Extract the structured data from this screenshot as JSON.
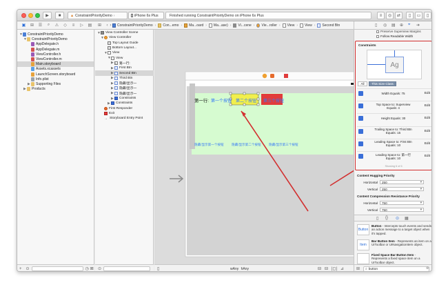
{
  "window": {
    "scheme_target": "ConstraintPriorityDemo",
    "scheme_device": "iPhone 6s Plus",
    "status_text": "Finished running ConstraintPriorityDemo on iPhone 6s Plus"
  },
  "jumpbar": [
    "ConstraintPriorityDemo",
    "Con...emo",
    "Ma...oard",
    "Ma...ase)",
    "Vi...cene",
    "Vie...roller",
    "View",
    "View",
    "Second Btn"
  ],
  "navigator": {
    "items": [
      {
        "label": "ConstraintPriorityDemo",
        "icon": "project",
        "level": 0,
        "disclosure": "▼",
        "selected": false
      },
      {
        "label": "ConstraintPriorityDemo",
        "icon": "folder",
        "level": 1,
        "disclosure": "▼",
        "selected": false
      },
      {
        "label": "AppDelegate.h",
        "icon": "h",
        "level": 2,
        "disclosure": "",
        "selected": false
      },
      {
        "label": "AppDelegate.m",
        "icon": "m",
        "level": 2,
        "disclosure": "",
        "selected": false
      },
      {
        "label": "ViewController.h",
        "icon": "h",
        "level": 2,
        "disclosure": "",
        "selected": false
      },
      {
        "label": "ViewController.m",
        "icon": "m",
        "level": 2,
        "disclosure": "",
        "selected": false
      },
      {
        "label": "Main.storyboard",
        "icon": "sb",
        "level": 2,
        "disclosure": "",
        "selected": true
      },
      {
        "label": "Assets.xcassets",
        "icon": "assets",
        "level": 2,
        "disclosure": "",
        "selected": false
      },
      {
        "label": "LaunchScreen.storyboard",
        "icon": "sb",
        "level": 2,
        "disclosure": "",
        "selected": false
      },
      {
        "label": "Info.plist",
        "icon": "plist",
        "level": 2,
        "disclosure": "",
        "selected": false
      },
      {
        "label": "Supporting Files",
        "icon": "folder",
        "level": 2,
        "disclosure": "▶",
        "selected": false
      },
      {
        "label": "Products",
        "icon": "folder",
        "level": 1,
        "disclosure": "▶",
        "selected": false
      }
    ]
  },
  "outline": {
    "items": [
      {
        "label": "View Controller Scene",
        "icon": "scene",
        "level": 0,
        "disclosure": "▼",
        "selected": false
      },
      {
        "label": "View Controller",
        "icon": "vc",
        "level": 1,
        "disclosure": "▼",
        "selected": false
      },
      {
        "label": "Top Layout Guide",
        "icon": "guide",
        "level": 2,
        "disclosure": "",
        "selected": false
      },
      {
        "label": "Bottom Layout...",
        "icon": "guide",
        "level": 2,
        "disclosure": "",
        "selected": false
      },
      {
        "label": "View",
        "icon": "view",
        "level": 2,
        "disclosure": "▼",
        "selected": false
      },
      {
        "label": "View",
        "icon": "view",
        "level": 3,
        "disclosure": "▼",
        "selected": false
      },
      {
        "label": "第一行:",
        "icon": "label",
        "level": 4,
        "disclosure": "▶",
        "selected": false
      },
      {
        "label": "First Btn",
        "icon": "button",
        "level": 4,
        "disclosure": "▶",
        "selected": false
      },
      {
        "label": "Second Btn",
        "icon": "button",
        "level": 4,
        "disclosure": "▶",
        "selected": true
      },
      {
        "label": "Third Btn",
        "icon": "button",
        "level": 4,
        "disclosure": "▶",
        "selected": false
      },
      {
        "label": "隐藏/显示一",
        "icon": "button",
        "level": 4,
        "disclosure": "▶",
        "selected": false
      },
      {
        "label": "隐藏/显示一",
        "icon": "button",
        "level": 4,
        "disclosure": "▶",
        "selected": false
      },
      {
        "label": "隐藏/显示一",
        "icon": "button",
        "level": 4,
        "disclosure": "▶",
        "selected": false
      },
      {
        "label": "Constraints",
        "icon": "constraints",
        "level": 4,
        "disclosure": "▶",
        "selected": false
      },
      {
        "label": "Constraints",
        "icon": "constraints",
        "level": 3,
        "disclosure": "▶",
        "selected": false
      },
      {
        "label": "First Responder",
        "icon": "responder",
        "level": 1,
        "disclosure": "",
        "selected": false
      },
      {
        "label": "Exit",
        "icon": "exit",
        "level": 1,
        "disclosure": "",
        "selected": false
      },
      {
        "label": "Storyboard Entry Point",
        "icon": "arrow",
        "level": 1,
        "disclosure": "",
        "selected": false
      }
    ]
  },
  "canvas": {
    "row1_label": "第一行:",
    "btn1": "第一个按钮",
    "btn2": "第二个按钮",
    "btn3": "第三个按钮",
    "row2": [
      "隐藏/显示第一个按钮",
      "隐藏/显示第二个按钮",
      "隐藏/显示第三个按钮"
    ],
    "size_class_w": "w",
    "size_class_any1": "Any",
    "size_class_h": "h",
    "size_class_any2": "Any",
    "colors": {
      "green": "#d6fbd0",
      "yellow": "#f1ef4c",
      "red": "#e23b3b",
      "blue_text": "#3478f6",
      "arrow": "#d23030"
    }
  },
  "inspector": {
    "hidden_top_label": "Preserve Superview Margins",
    "follow_readable": "Follow Readable Width",
    "constraints_title": "Constraints",
    "preview_text": "Ag",
    "filter_all": "All",
    "filter_size_class": "This Size Class",
    "constraints": [
      {
        "line1": "Width Equals:  75",
        "line2": ""
      },
      {
        "line1": "Top Space to: Superview",
        "line2": "Equals:  4"
      },
      {
        "line1": "Height Equals:  30",
        "line2": ""
      },
      {
        "line1": "Trailing Space to: Third Btn",
        "line2": "Equals:  15"
      },
      {
        "line1": "Leading Space to: First Btn",
        "line2": "Equals:  10"
      },
      {
        "line1": "Leading Space to: 第一行",
        "line2": "Equals:  10"
      }
    ],
    "edit_label": "Edit",
    "showing": "Showing 6 of 6",
    "hugging_title": "Content Hugging Priority",
    "compression_title": "Content Compression Resistance Priority",
    "horizontal_label": "Horizontal",
    "vertical_label": "Vertical",
    "hug_h": "250",
    "hug_v": "250",
    "comp_h": "750",
    "comp_v": "750",
    "library": [
      {
        "icon_text": "Button",
        "title": "Button",
        "desc": " - Intercepts touch events and sends an action message to a target object when it's tapped."
      },
      {
        "icon_text": "Item",
        "title": "Bar Button Item",
        "desc": " - Represents an item on a UIToolbar or UINavigationItem object."
      },
      {
        "icon_text": "",
        "title": "Fixed Space Bar Button Item",
        "desc": " - Represents a fixed space item on a UIToolbar object."
      }
    ],
    "search_value": "button"
  }
}
